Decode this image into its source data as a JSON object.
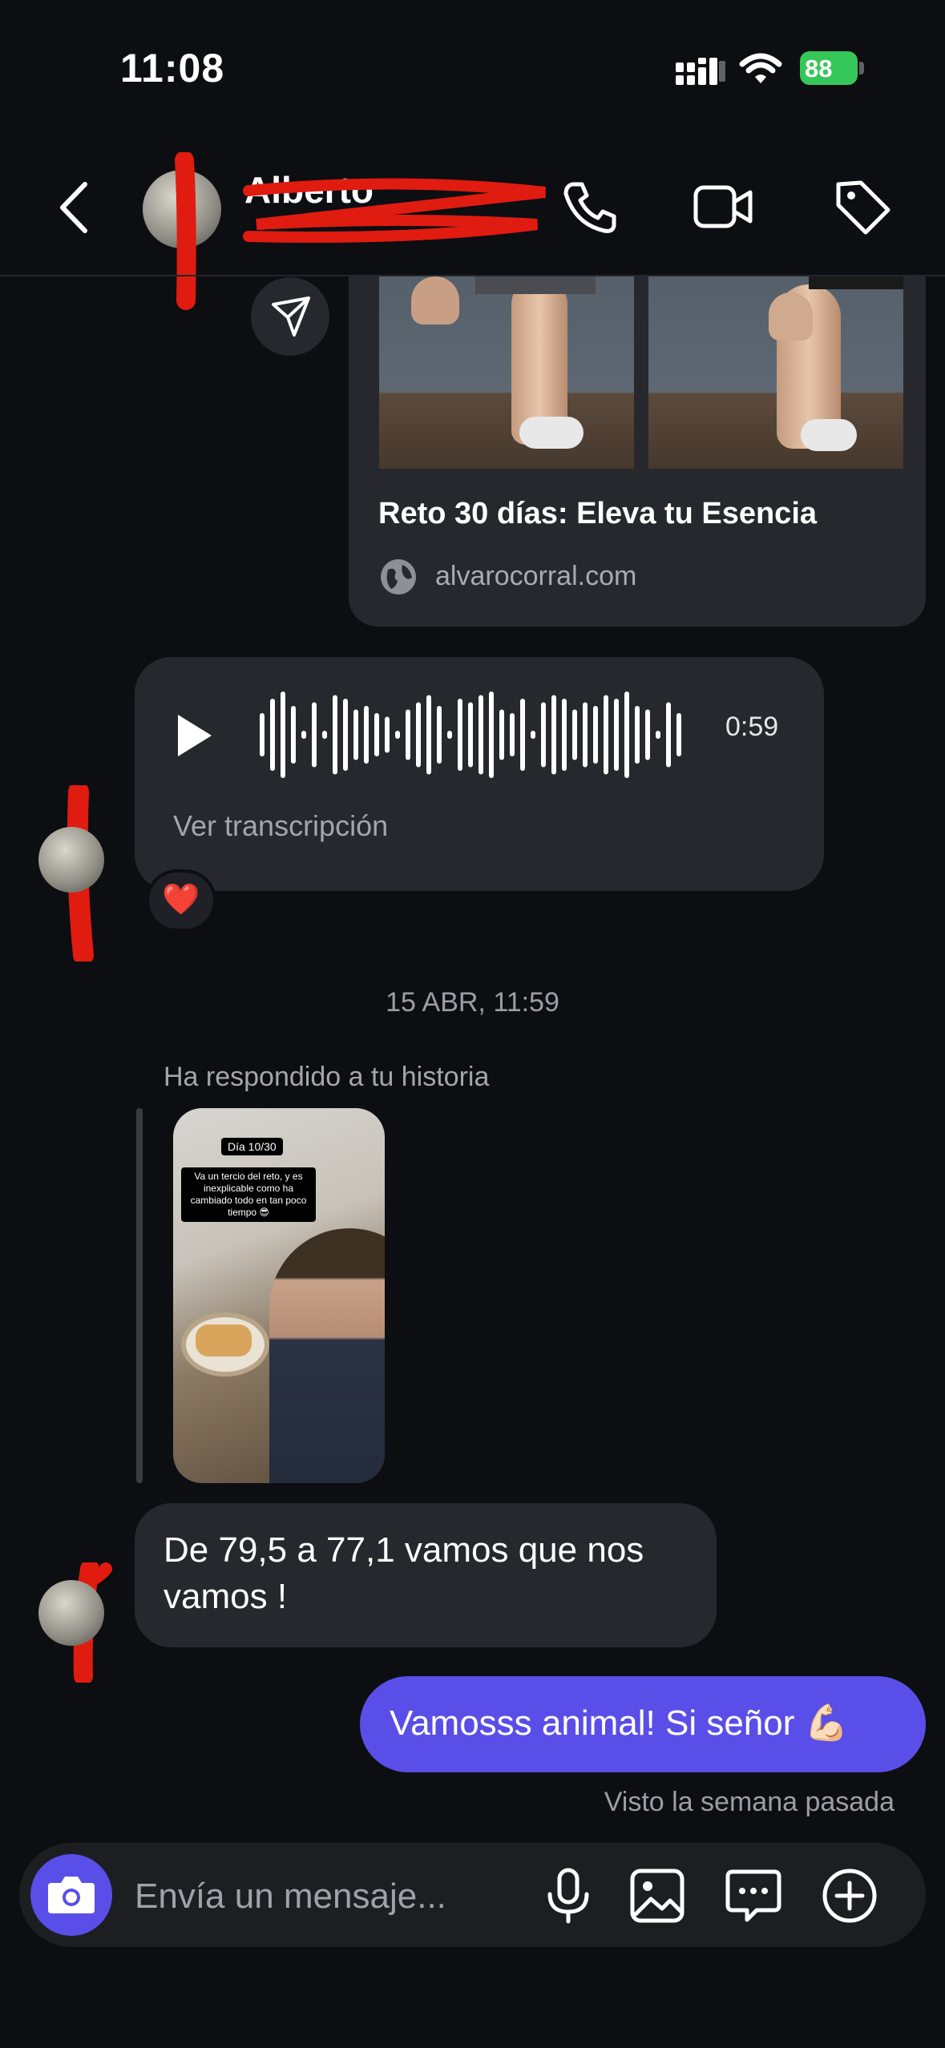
{
  "status_bar": {
    "time": "11:08",
    "battery": "88"
  },
  "header": {
    "contact_name": "Alberto",
    "icons": [
      "back-icon",
      "phone-icon",
      "video-icon",
      "tag-icon"
    ]
  },
  "link_card": {
    "title": "Reto 30 días: Eleva tu Esencia",
    "domain": "alvarocorral.com"
  },
  "voice_message": {
    "duration": "0:59",
    "transcript_label": "Ver transcripción",
    "reaction": "❤️"
  },
  "date_divider": "15 ABR, 11:59",
  "story_reply": {
    "label": "Ha respondido a tu historia",
    "story_tag": "Día 10/30",
    "story_caption": "Va un tercio del reto, y es inexplicable como ha cambiado todo en tan poco tiempo 😎"
  },
  "messages": {
    "incoming": "De 79,5 a 77,1 vamos que nos vamos !",
    "outgoing": "Vamosss animal! Si señor 💪🏻",
    "seen": "Visto la semana pasada"
  },
  "composer": {
    "placeholder": "Envía un mensaje..."
  },
  "colors": {
    "background": "#0c0e12",
    "bubble": "#26282d",
    "accent": "#5a4ee8",
    "battery": "#35c759",
    "redaction": "#e01b10"
  }
}
